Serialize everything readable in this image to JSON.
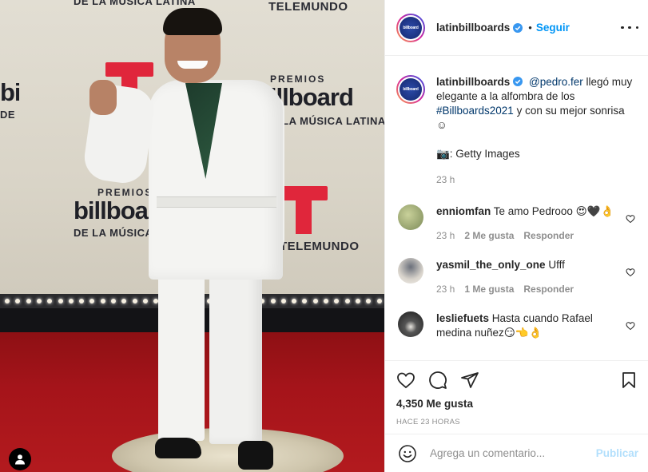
{
  "post": {
    "backdrop": {
      "award_line1": "PREMIOS",
      "award_brand": "billboard",
      "award_line3": "DE LA MÚSICA LATINA",
      "network": "TELEMUNDO",
      "top_text": "DE LA MÚSICA LATINA"
    }
  },
  "header": {
    "username": "latinbillboards",
    "separator": "•",
    "follow_label": "Seguir"
  },
  "caption": {
    "username": "latinbillboards",
    "mention": "@pedro.fer",
    "text_1": " llegó muy elegante a la alfombra de los ",
    "hashtag": "#Billboards2021",
    "text_2": " y con su mejor sonrisa ☺",
    "credit": "📷: Getty Images",
    "time": "23 h"
  },
  "comments": [
    {
      "username": "enniomfan",
      "text": "Te amo Pedrooo 😍🖤👌",
      "time": "23 h",
      "likes": "2 Me gusta",
      "reply": "Responder",
      "avatar_color": "#9aa679"
    },
    {
      "username": "yasmil_the_only_one",
      "text": "Ufff",
      "time": "23 h",
      "likes": "1 Me gusta",
      "reply": "Responder",
      "avatar_color": "#c9c4bd"
    },
    {
      "username": "lesliefuets",
      "text": "Hasta cuando Rafael medina nuñez😏👈👌",
      "time": "",
      "likes": "",
      "reply": "",
      "avatar_color": "#2f2f2f"
    }
  ],
  "actions": {
    "likes": "4,350 Me gusta",
    "posted": "HACE 23 HORAS"
  },
  "composer": {
    "placeholder": "Agrega un comentario...",
    "publish_label": "Publicar"
  },
  "colors": {
    "accent": "#0095f6",
    "publish_disabled": "#b2dffc",
    "telemundo_red": "#e0263b"
  }
}
